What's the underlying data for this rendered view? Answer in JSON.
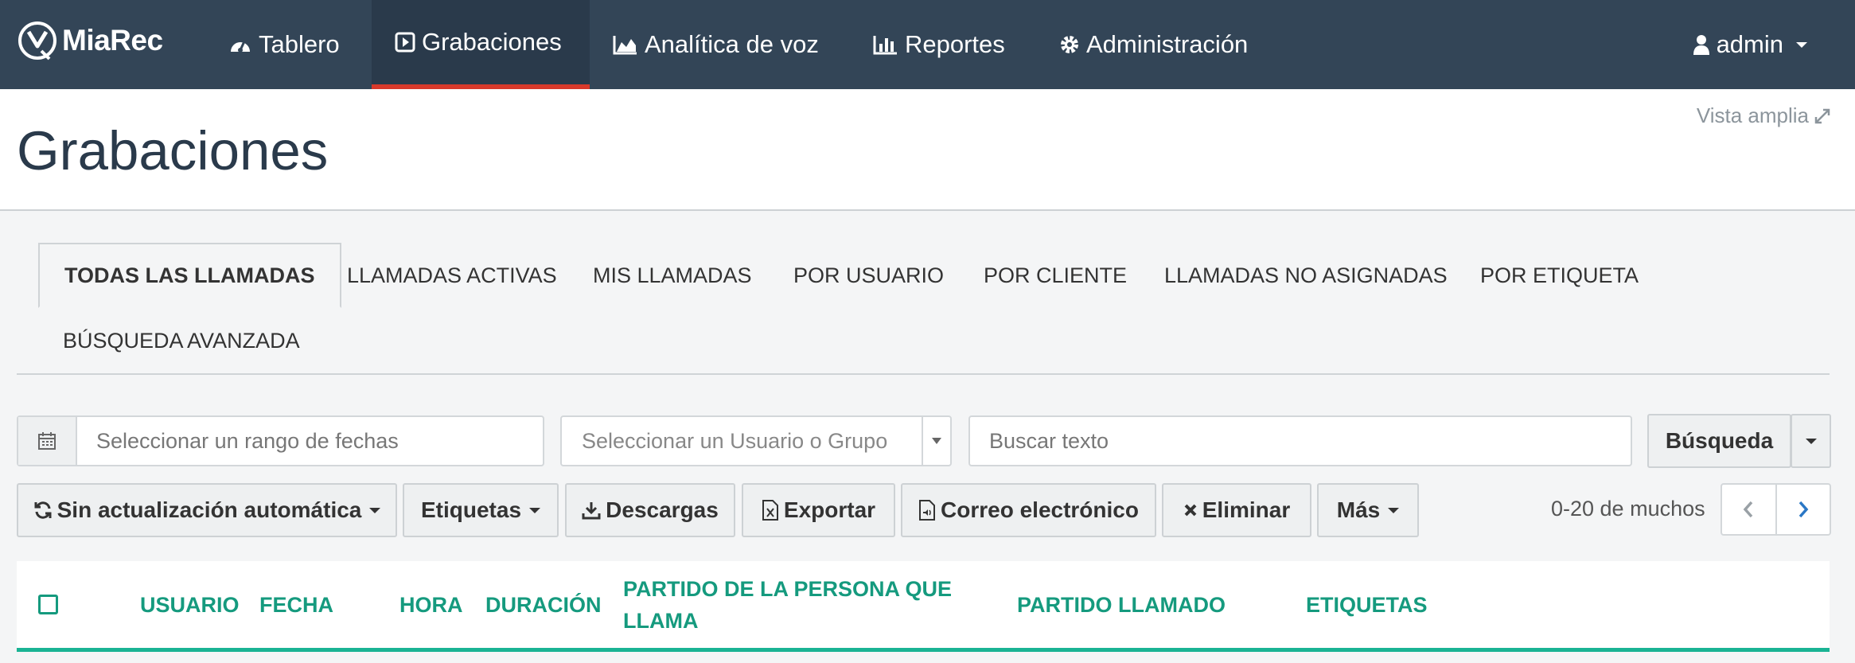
{
  "brand": {
    "name": "MiaRec"
  },
  "nav": {
    "items": [
      {
        "label": "Tablero",
        "icon": "dashboard-icon"
      },
      {
        "label": "Grabaciones",
        "icon": "play-icon",
        "active": true
      },
      {
        "label": "Analítica de voz",
        "icon": "area-chart-icon"
      },
      {
        "label": "Reportes",
        "icon": "bar-chart-icon"
      },
      {
        "label": "Administración",
        "icon": "gear-icon"
      }
    ],
    "user": "admin"
  },
  "header": {
    "title": "Grabaciones",
    "wide_view": "Vista amplia"
  },
  "tabs": [
    {
      "label": "TODAS LAS LLAMADAS",
      "active": true
    },
    {
      "label": "LLAMADAS ACTIVAS"
    },
    {
      "label": "MIS LLAMADAS"
    },
    {
      "label": "POR USUARIO"
    },
    {
      "label": "POR CLIENTE"
    },
    {
      "label": "LLAMADAS NO ASIGNADAS"
    },
    {
      "label": "POR ETIQUETA"
    },
    {
      "label": "BÚSQUEDA AVANZADA"
    }
  ],
  "filters": {
    "date_placeholder": "Seleccionar un rango de fechas",
    "user_placeholder": "Seleccionar un Usuario o Grupo",
    "text_placeholder": "Buscar texto",
    "search_label": "Búsqueda"
  },
  "toolbar": {
    "autorefresh": "Sin actualización automática",
    "tags": "Etiquetas",
    "downloads": "Descargas",
    "export": "Exportar",
    "email": "Correo electrónico",
    "delete": "Eliminar",
    "more": "Más",
    "pagination": "0-20 de muchos"
  },
  "table": {
    "columns": [
      "USUARIO",
      "FECHA",
      "HORA",
      "DURACIÓN",
      "PARTIDO DE LA PERSONA QUE LLAMA",
      "PARTIDO LLAMADO",
      "ETIQUETAS"
    ]
  },
  "colors": {
    "nav_bg": "#334557",
    "active_underline": "#d8392b",
    "accent": "#1ab394"
  }
}
